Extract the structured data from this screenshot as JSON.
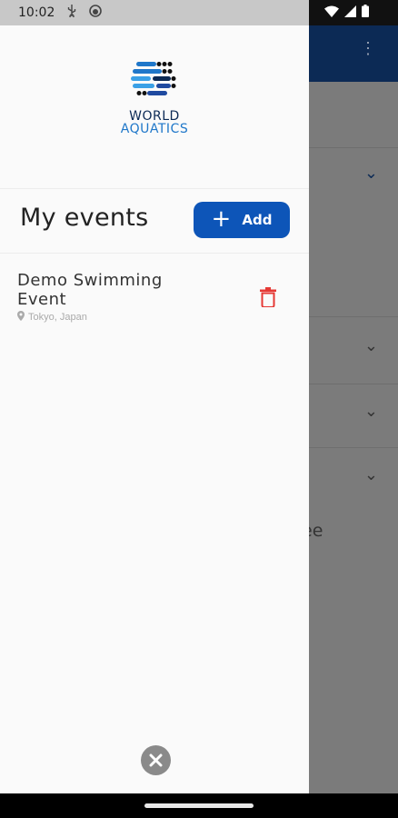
{
  "status_bar": {
    "time": "10:02"
  },
  "drawer": {
    "logo": {
      "line1": "WORLD",
      "line2": "AQUATICS"
    },
    "title": "My events",
    "add_button": {
      "label": "Add"
    },
    "events": [
      {
        "name": "Demo Swimming Event",
        "location": "Tokyo, Japan"
      }
    ]
  },
  "background": {
    "partial_text": "ee"
  },
  "colors": {
    "brand_blue": "#0d55b8",
    "navy": "#0c2a55",
    "delete_red": "#e53935"
  }
}
